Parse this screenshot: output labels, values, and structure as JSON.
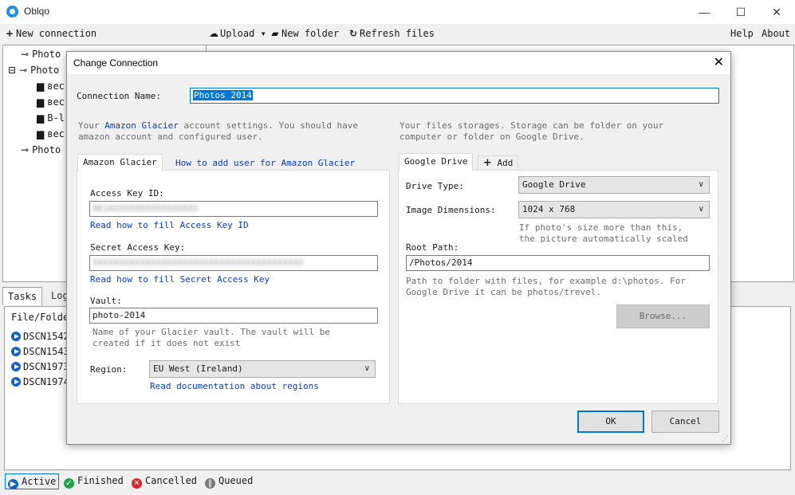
{
  "window": {
    "title": "Oblqo",
    "controls": {
      "minimize": "—",
      "maximize": "☐",
      "close": "✕"
    }
  },
  "menu": {
    "new_connection": "New connection",
    "upload": "Upload ▾",
    "new_folder": "New folder",
    "refresh_files": "Refresh files",
    "help": "Help",
    "about": "About"
  },
  "tree": {
    "items": [
      {
        "label": "Photo",
        "expander": "",
        "icon": "plug-icon"
      },
      {
        "label": "Photo",
        "expander": "⊟",
        "icon": "plug-icon"
      },
      {
        "label": "вес",
        "expander": "",
        "icon": "folder-icon"
      },
      {
        "label": "вес",
        "expander": "",
        "icon": "folder-icon"
      },
      {
        "label": "B-l",
        "expander": "",
        "icon": "folder-icon"
      },
      {
        "label": "вес",
        "expander": "",
        "icon": "folder-icon"
      },
      {
        "label": "Photo",
        "expander": "",
        "icon": "plug-icon"
      }
    ]
  },
  "tasks": {
    "tabs": [
      "Tasks",
      "Log"
    ],
    "column_header": "File/Folde",
    "rows": [
      "DSCN1542",
      "DSCN1543",
      "DSCN1973",
      "DSCN1974"
    ]
  },
  "status": {
    "active": "Active",
    "finished": "Finished",
    "cancelled": "Cancelled",
    "queued": "Queued",
    "colors": {
      "active": "#1560c8",
      "finished": "#1ea34a",
      "cancelled": "#d9262d",
      "queued": "#7a7a7a"
    }
  },
  "dialog": {
    "title": "Change Connection",
    "close": "✕",
    "connection_name_label": "Connection Name:",
    "connection_name_value": "Photos 2014",
    "glacier_intro_pre": "Your ",
    "glacier_intro_link": "Amazon Glacier",
    "glacier_intro_post": " account settings. You should have",
    "glacier_intro_line2": "amazon account and configured user.",
    "storage_intro_line1": "Your files storages. Storage can be folder on your",
    "storage_intro_line2": "computer or folder on Google Drive.",
    "glacier_tab": "Amazon Glacier",
    "glacier_howto_link": "How to add user for Amazon Glacier",
    "access_key_label": "Access Key ID:",
    "access_key_value": "AKIAXXXXXXXXXXXXXXXX",
    "access_key_help": "Read how to fill Access Key ID",
    "secret_key_label": "Secret Access Key:",
    "secret_key_value": "XXXXXXXXXXXXXXXXXXXXXXXXXXXXXXXXXXXXXXXX",
    "secret_key_help": "Read how to fill Secret Access Key",
    "vault_label": "Vault:",
    "vault_value": "photo-2014",
    "vault_hint_line1": "Name of your Glacier vault. The vault will be",
    "vault_hint_line2": "created if it does not exist",
    "region_label": "Region:",
    "region_value": "EU West (Ireland)",
    "region_doc_link": "Read documentation about regions",
    "storage_tab": "Google Drive",
    "add_tab": "Add",
    "drive_type_label": "Drive Type:",
    "drive_type_value": "Google Drive",
    "image_dim_label": "Image Dimensions:",
    "image_dim_value": "1024 x 768",
    "image_dim_hint_line1": "If photo's size more than this,",
    "image_dim_hint_line2": "the picture automatically scaled",
    "root_path_label": "Root Path:",
    "root_path_value": "/Photos/2014",
    "root_path_hint_line1": "Path to folder with files, for example d:\\photos. For",
    "root_path_hint_line2": "Google Drive it can be photos/trevel.",
    "browse": "Browse...",
    "ok": "OK",
    "cancel": "Cancel"
  }
}
